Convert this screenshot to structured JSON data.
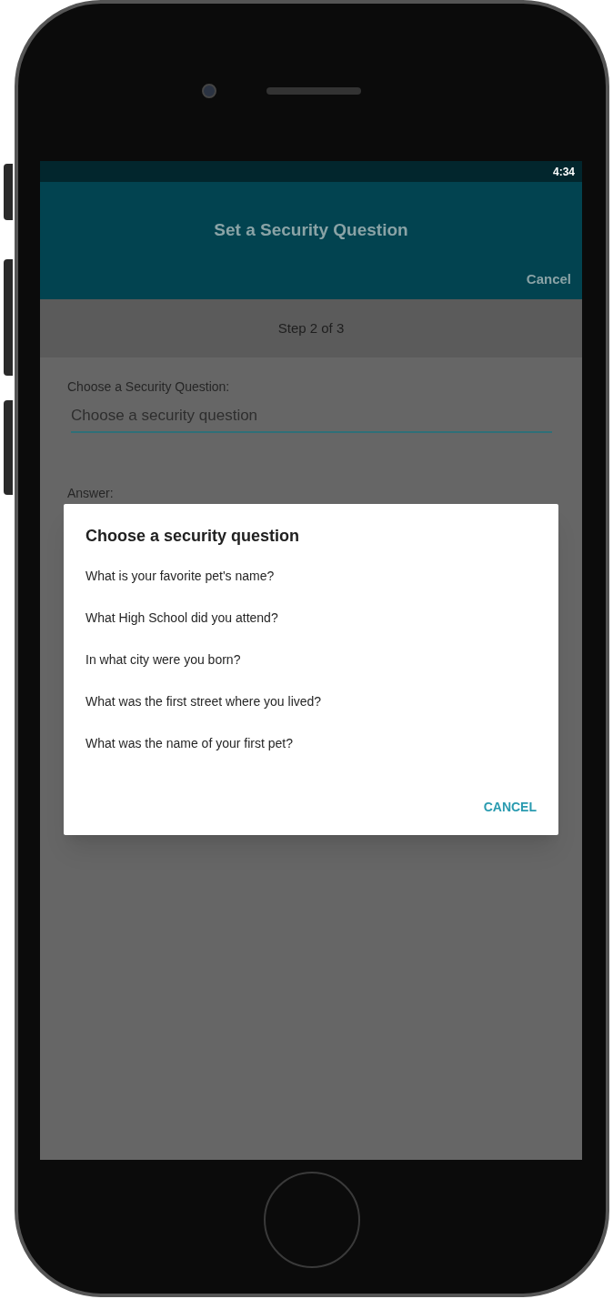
{
  "status_bar": {
    "time": "4:34"
  },
  "app_bar": {
    "title": "Set a Security Question",
    "action": "Cancel"
  },
  "step": "Step 2 of 3",
  "form": [
    {
      "label": "Choose a Security Question:",
      "placeholder": "Choose a security question"
    },
    {
      "label": "Answer:"
    }
  ],
  "dialog": {
    "title": "Choose a security question",
    "options": [
      "What is your favorite pet's name?",
      "What High School did you attend?",
      "In what city were you born?",
      "What was the first street where you lived?",
      "What was the name of your first pet?"
    ],
    "button": "CANCEL"
  }
}
